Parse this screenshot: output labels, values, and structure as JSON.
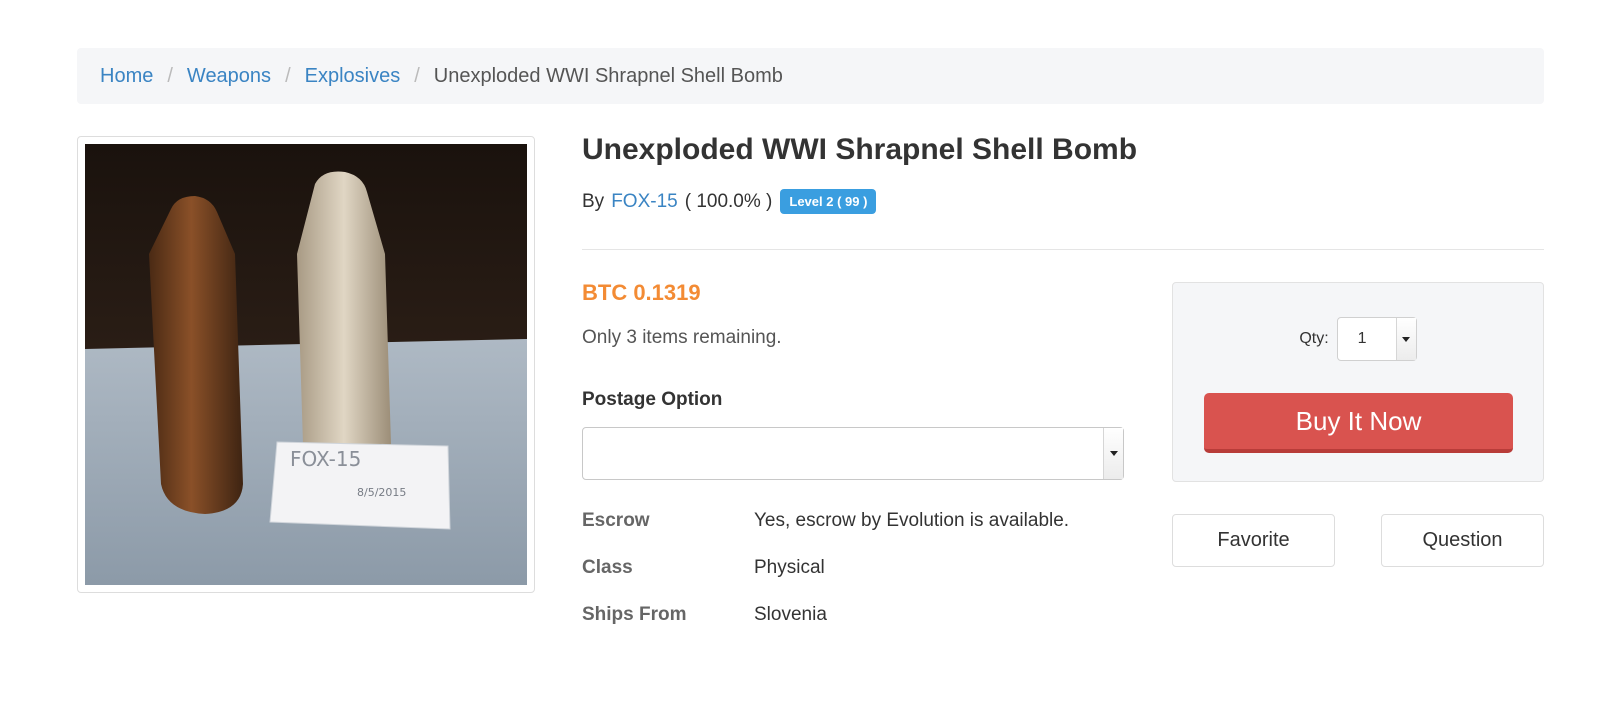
{
  "breadcrumb": {
    "home": "Home",
    "weapons": "Weapons",
    "explosives": "Explosives",
    "current": "Unexploded WWI Shrapnel Shell Bomb",
    "separator": "/"
  },
  "product": {
    "title": "Unexploded WWI Shrapnel Shell Bomb",
    "image_label": {
      "line1": "FOX-15",
      "line2": "8/5/2015"
    },
    "seller": {
      "prefix": "By",
      "name": "FOX-15",
      "rating": "( 100.0% )",
      "level": "Level 2 ( 99 )"
    },
    "price": "BTC 0.1319",
    "stock": "Only 3 items remaining.",
    "postage": {
      "label": "Postage Option",
      "selected": ""
    },
    "details": [
      {
        "key": "Escrow",
        "value": "Yes, escrow by Evolution is available."
      },
      {
        "key": "Class",
        "value": "Physical"
      },
      {
        "key": "Ships From",
        "value": "Slovenia"
      }
    ]
  },
  "purchase": {
    "qty_label": "Qty:",
    "qty_value": "1",
    "buy_label": "Buy It Now",
    "favorite_label": "Favorite",
    "question_label": "Question"
  },
  "icons": {
    "select_arrow": "chevron-down-icon"
  },
  "colors": {
    "link": "#3a84c3",
    "price": "#f38b34",
    "buy_button": "#d9534f",
    "level_badge": "#3a9ee0"
  }
}
